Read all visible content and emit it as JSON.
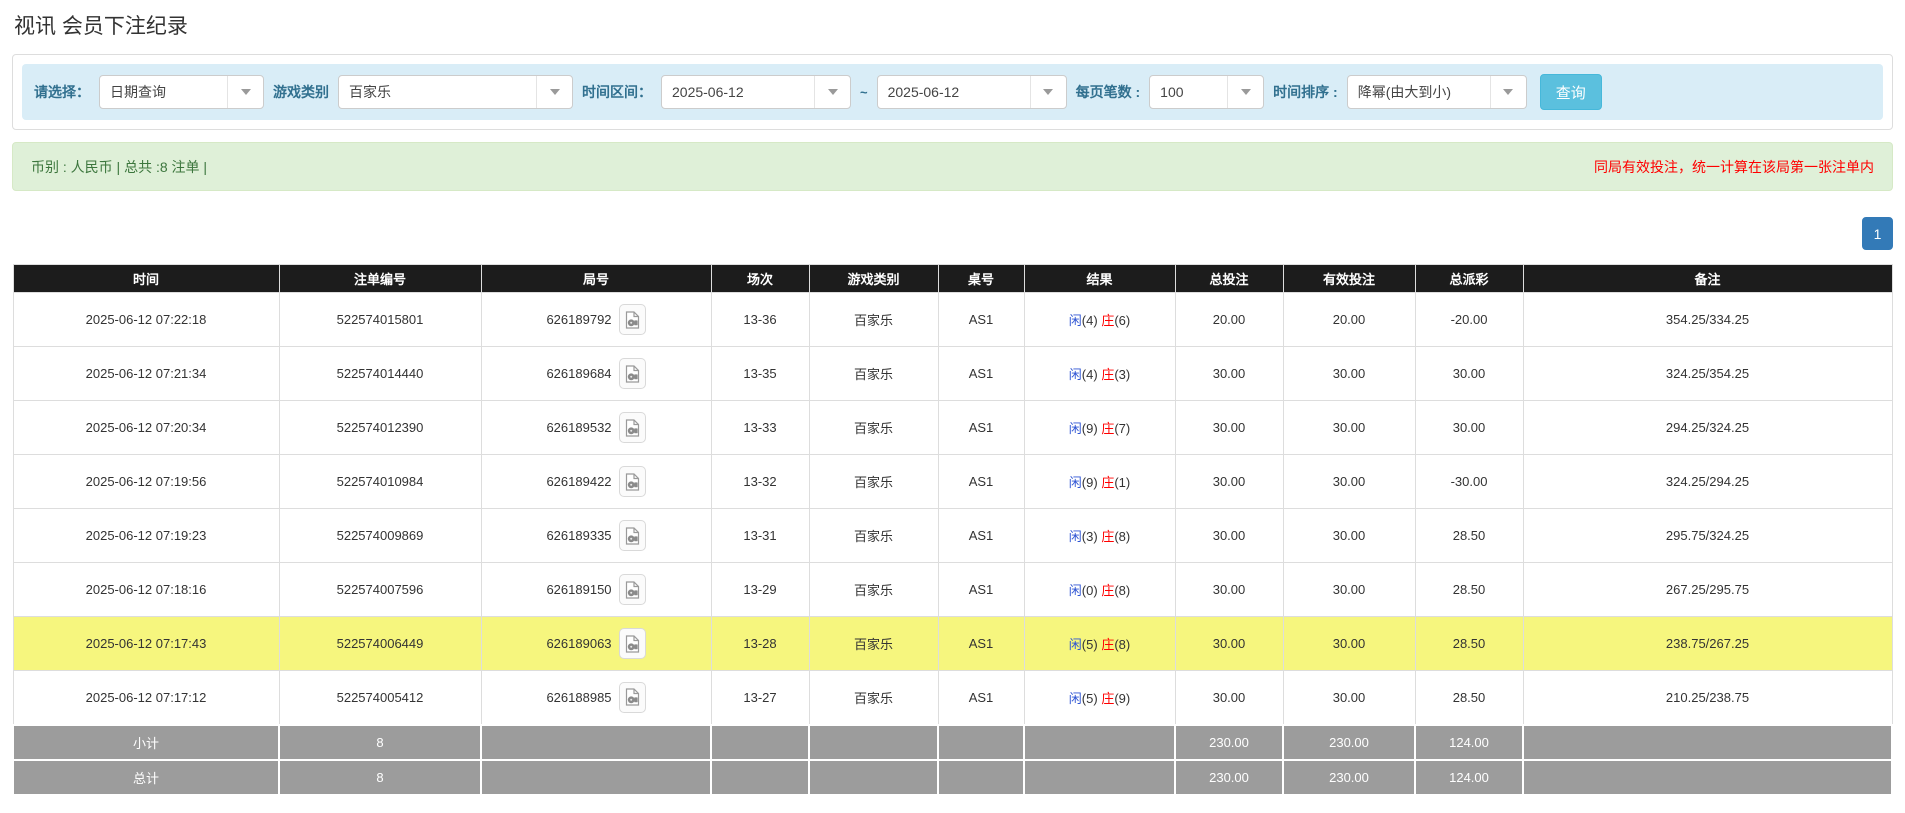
{
  "page": {
    "title": "视讯 会员下注纪录"
  },
  "filters": {
    "choose_label": "请选择：",
    "choose_value": "日期查询",
    "game_label": "游戏类别",
    "game_value": "百家乐",
    "range_label": "时间区间：",
    "date_from": "2025-06-12",
    "range_separator": "~",
    "date_to": "2025-06-12",
    "per_page_label": "每页笔数 :",
    "per_page_value": "100",
    "sort_label": "时间排序 :",
    "sort_value": "降幂(由大到小)",
    "search_button": "查询"
  },
  "summary_bar": {
    "left": "币别 : 人民币 | 总共 :8 注单 |",
    "right": "同局有效投注，统一计算在该局第一张注单内"
  },
  "pagination": {
    "current_page": "1"
  },
  "colors": {
    "header_bg": "#1c1c1c",
    "highlight_row": "#f6f67e",
    "summary_row_bg": "#9c9c9c",
    "amount_blue": "#2f80e0",
    "negative_red": "#ff0000",
    "search_button_bg": "#5bc0de",
    "active_page_bg": "#337ab7"
  },
  "table": {
    "columns": [
      "时间",
      "注单编号",
      "局号",
      "场次",
      "游戏类别",
      "桌号",
      "结果",
      "总投注",
      "有效投注",
      "总派彩",
      "备注"
    ],
    "video_icon_name": "video-replay-icon",
    "rows": [
      {
        "time": "2025-06-12 07:22:18",
        "bet_no": "522574015801",
        "round_no": "626189792",
        "session": "13-36",
        "game": "百家乐",
        "table_no": "AS1",
        "result_player": "闲",
        "result_player_score": "(4)",
        "result_banker": "庄",
        "result_banker_score": "(6)",
        "total_bet": "20.00",
        "valid_bet": "20.00",
        "payout": "-20.00",
        "payout_negative": true,
        "remark": "354.25/334.25",
        "highlight": false
      },
      {
        "time": "2025-06-12 07:21:34",
        "bet_no": "522574014440",
        "round_no": "626189684",
        "session": "13-35",
        "game": "百家乐",
        "table_no": "AS1",
        "result_player": "闲",
        "result_player_score": "(4)",
        "result_banker": "庄",
        "result_banker_score": "(3)",
        "total_bet": "30.00",
        "valid_bet": "30.00",
        "payout": "30.00",
        "payout_negative": false,
        "remark": "324.25/354.25",
        "highlight": false
      },
      {
        "time": "2025-06-12 07:20:34",
        "bet_no": "522574012390",
        "round_no": "626189532",
        "session": "13-33",
        "game": "百家乐",
        "table_no": "AS1",
        "result_player": "闲",
        "result_player_score": "(9)",
        "result_banker": "庄",
        "result_banker_score": "(7)",
        "total_bet": "30.00",
        "valid_bet": "30.00",
        "payout": "30.00",
        "payout_negative": false,
        "remark": "294.25/324.25",
        "highlight": false
      },
      {
        "time": "2025-06-12 07:19:56",
        "bet_no": "522574010984",
        "round_no": "626189422",
        "session": "13-32",
        "game": "百家乐",
        "table_no": "AS1",
        "result_player": "闲",
        "result_player_score": "(9)",
        "result_banker": "庄",
        "result_banker_score": "(1)",
        "total_bet": "30.00",
        "valid_bet": "30.00",
        "payout": "-30.00",
        "payout_negative": true,
        "remark": "324.25/294.25",
        "highlight": false
      },
      {
        "time": "2025-06-12 07:19:23",
        "bet_no": "522574009869",
        "round_no": "626189335",
        "session": "13-31",
        "game": "百家乐",
        "table_no": "AS1",
        "result_player": "闲",
        "result_player_score": "(3)",
        "result_banker": "庄",
        "result_banker_score": "(8)",
        "total_bet": "30.00",
        "valid_bet": "30.00",
        "payout": "28.50",
        "payout_negative": false,
        "remark": "295.75/324.25",
        "highlight": false
      },
      {
        "time": "2025-06-12 07:18:16",
        "bet_no": "522574007596",
        "round_no": "626189150",
        "session": "13-29",
        "game": "百家乐",
        "table_no": "AS1",
        "result_player": "闲",
        "result_player_score": "(0)",
        "result_banker": "庄",
        "result_banker_score": "(8)",
        "total_bet": "30.00",
        "valid_bet": "30.00",
        "payout": "28.50",
        "payout_negative": false,
        "remark": "267.25/295.75",
        "highlight": false
      },
      {
        "time": "2025-06-12 07:17:43",
        "bet_no": "522574006449",
        "round_no": "626189063",
        "session": "13-28",
        "game": "百家乐",
        "table_no": "AS1",
        "result_player": "闲",
        "result_player_score": "(5)",
        "result_banker": "庄",
        "result_banker_score": "(8)",
        "total_bet": "30.00",
        "valid_bet": "30.00",
        "payout": "28.50",
        "payout_negative": false,
        "remark": "238.75/267.25",
        "highlight": true
      },
      {
        "time": "2025-06-12 07:17:12",
        "bet_no": "522574005412",
        "round_no": "626188985",
        "session": "13-27",
        "game": "百家乐",
        "table_no": "AS1",
        "result_player": "闲",
        "result_player_score": "(5)",
        "result_banker": "庄",
        "result_banker_score": "(9)",
        "total_bet": "30.00",
        "valid_bet": "30.00",
        "payout": "28.50",
        "payout_negative": false,
        "remark": "210.25/238.75",
        "highlight": false
      }
    ],
    "summary_rows": [
      {
        "label": "小计",
        "count": "8",
        "total_bet": "230.00",
        "valid_bet": "230.00",
        "payout": "124.00"
      },
      {
        "label": "总计",
        "count": "8",
        "total_bet": "230.00",
        "valid_bet": "230.00",
        "payout": "124.00"
      }
    ]
  }
}
